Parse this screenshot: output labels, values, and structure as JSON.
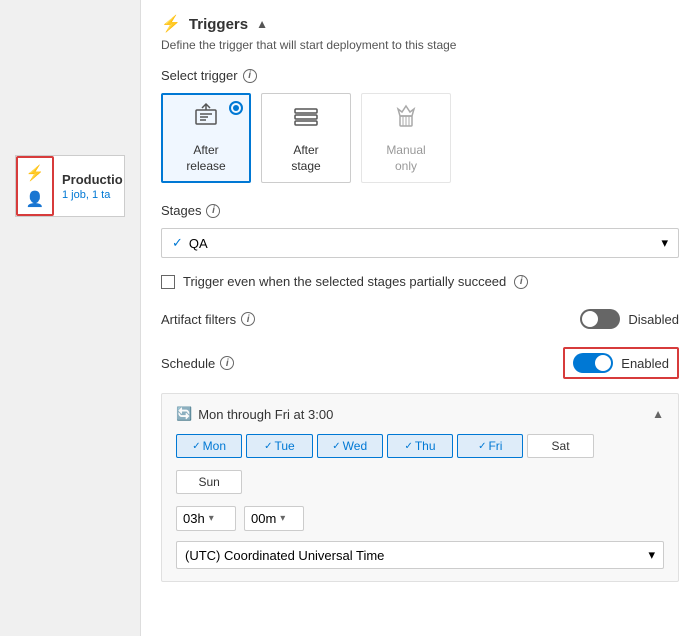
{
  "leftPanel": {
    "stageLabel": "Productio",
    "stageMeta": "1 job, 1 ta"
  },
  "rightPanel": {
    "headerIcon": "⚡",
    "headerTitle": "Triggers",
    "headerSubtitle": "Define the trigger that will start deployment to this stage",
    "selectTriggerLabel": "Select trigger",
    "triggerCards": [
      {
        "id": "after-release",
        "label": "After\nrelease",
        "selected": true
      },
      {
        "id": "after-stage",
        "label": "After\nstage",
        "selected": false
      },
      {
        "id": "manual-only",
        "label": "Manual\nonly",
        "selected": false,
        "disabled": true
      }
    ],
    "stagesLabel": "Stages",
    "stagesValue": "QA",
    "checkboxLabel": "Trigger even when the selected stages partially succeed",
    "artifactFiltersLabel": "Artifact filters",
    "artifactFiltersStatus": "Disabled",
    "scheduleLabel": "Schedule",
    "scheduleStatus": "Enabled",
    "scheduleSummary": "Mon through Fri at 3:00",
    "days": [
      {
        "id": "mon",
        "label": "Mon",
        "active": true
      },
      {
        "id": "tue",
        "label": "Tue",
        "active": true
      },
      {
        "id": "wed",
        "label": "Wed",
        "active": true
      },
      {
        "id": "thu",
        "label": "Thu",
        "active": true
      },
      {
        "id": "fri",
        "label": "Fri",
        "active": true
      },
      {
        "id": "sat",
        "label": "Sat",
        "active": false
      },
      {
        "id": "sun",
        "label": "Sun",
        "active": false
      }
    ],
    "hourValue": "03h",
    "minuteValue": "00m",
    "timezone": "(UTC) Coordinated Universal Time"
  }
}
